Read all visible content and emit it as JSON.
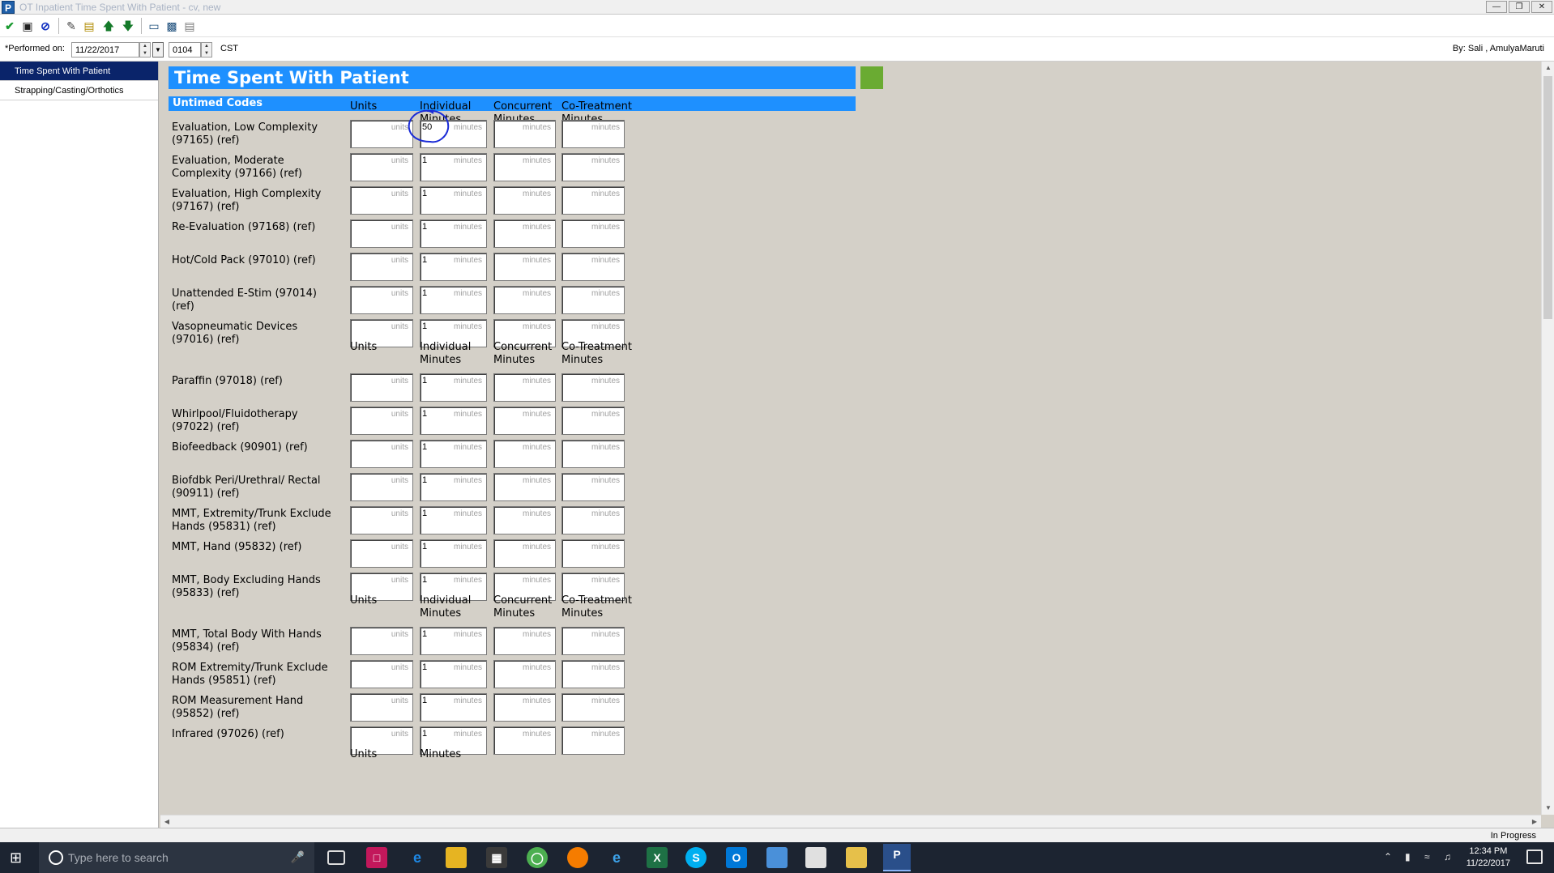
{
  "window": {
    "title": "OT Inpatient Time Spent With Patient - cv, new",
    "app_icon_letter": "P"
  },
  "performed": {
    "label": "*Performed on:",
    "date": "11/22/2017",
    "time": "0104",
    "timezone": "CST",
    "by": "By:  Sali , AmulyaMaruti"
  },
  "sidebar": {
    "items": [
      {
        "label": "Time Spent With Patient"
      },
      {
        "label": "Strapping/Casting/Orthotics"
      }
    ]
  },
  "form": {
    "title": "Time Spent With Patient",
    "section": "Untimed Codes",
    "col_headers": {
      "units": "Units",
      "individual": "Individual Minutes",
      "concurrent": "Concurrent Minutes",
      "cotreatment": "Co-Treatment Minutes"
    },
    "placeholders": {
      "units": "units",
      "minutes": "minutes"
    },
    "rows": [
      {
        "label": "Evaluation, Low Complexity (97165) (ref)",
        "individual": "50"
      },
      {
        "label": "Evaluation, Moderate Complexity (97166) (ref)",
        "individual": "1"
      },
      {
        "label": "Evaluation, High Complexity (97167) (ref)",
        "individual": "1"
      },
      {
        "label": "Re-Evaluation (97168) (ref)",
        "individual": "1"
      },
      {
        "label": "Hot/Cold Pack (97010) (ref)",
        "individual": "1"
      },
      {
        "label": "Unattended E-Stim (97014) (ref)",
        "individual": "1"
      },
      {
        "label": "Vasopneumatic Devices (97016) (ref)",
        "individual": "1"
      },
      {
        "label": "Paraffin (97018) (ref)",
        "individual": "1"
      },
      {
        "label": "Whirlpool/Fluidotherapy (97022) (ref)",
        "individual": "1"
      },
      {
        "label": "Biofeedback (90901) (ref)",
        "individual": "1"
      },
      {
        "label": "Biofdbk Peri/Urethral/ Rectal (90911) (ref)",
        "individual": "1"
      },
      {
        "label": "MMT, Extremity/Trunk Exclude Hands (95831) (ref)",
        "individual": "1"
      },
      {
        "label": "MMT, Hand (95832) (ref)",
        "individual": "1"
      },
      {
        "label": "MMT, Body Excluding Hands (95833) (ref)",
        "individual": "1"
      },
      {
        "label": "MMT, Total Body With Hands (95834) (ref)",
        "individual": "1"
      },
      {
        "label": "ROM Extremity/Trunk Exclude Hands (95851) (ref)",
        "individual": "1"
      },
      {
        "label": "ROM Measurement Hand (95852) (ref)",
        "individual": "1"
      },
      {
        "label": "Infrared (97026) (ref)",
        "individual": "1"
      }
    ],
    "trailing_headers": {
      "units": "Units",
      "minutes": "Minutes"
    }
  },
  "status": {
    "text": "In Progress"
  },
  "taskbar": {
    "search_placeholder": "Type here to search",
    "time": "12:34 PM",
    "date": "11/22/2017"
  }
}
